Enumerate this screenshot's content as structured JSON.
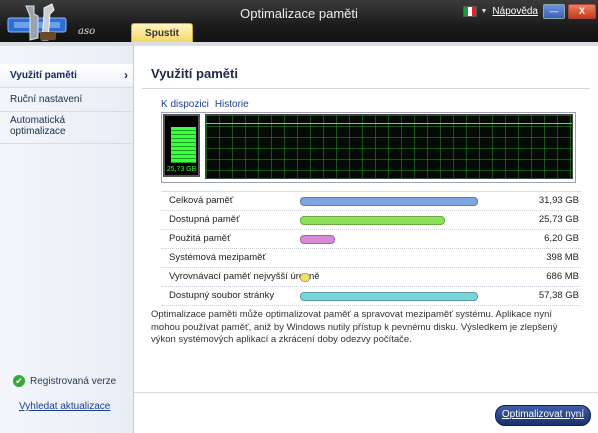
{
  "window": {
    "title": "Optimalizace paměti",
    "help_label": "Nápověda",
    "logo_text": "aso"
  },
  "tabs": {
    "run_label": "Spustit"
  },
  "sidebar": {
    "items": [
      {
        "label": "Využití paměti",
        "active": true
      },
      {
        "label": "Ruční nastavení",
        "active": false
      },
      {
        "label": "Automatická optimalizace",
        "active": false
      }
    ],
    "registered_label": "Registrovaná verze",
    "update_link": "Vyhledat aktualizace"
  },
  "main": {
    "title": "Využití paměti",
    "view_tabs": [
      "K dispozici",
      "Historie"
    ],
    "gauge_label": "25,73 GB",
    "gauge_fill": 0.81,
    "stats": [
      {
        "label": "Celková paměť",
        "value": "31,93 GB",
        "fill": 1.0,
        "color": "#7ea6e0"
      },
      {
        "label": "Dostupná paměť",
        "value": "25,73 GB",
        "fill": 0.81,
        "color": "#8ee05a"
      },
      {
        "label": "Použitá paměť",
        "value": "6,20 GB",
        "fill": 0.19,
        "color": "#d88ad6"
      },
      {
        "label": "Systémová mezipaměť",
        "value": "398 MB",
        "fill": 0,
        "color": "#cccccc"
      },
      {
        "label": "Vyrovnávací paměť nejvyšší úrovně",
        "value": "686 MB",
        "fill": 0.02,
        "color": "#f0e070"
      },
      {
        "label": "Dostupný soubor stránky",
        "value": "57,38 GB",
        "fill": 1.0,
        "color": "#7ad4d8"
      }
    ],
    "description": "Optimalizace paměti může optimalizovat paměť a spravovat mezipaměť systému. Aplikace nyní mohou používat paměť, aniž by Windows nutily přístup k pevnému disku. Výsledkem je zlepšený výkon systémových aplikací a zkrácení doby odezvy počítače.",
    "optimize_button": "Optimalizovat nyní"
  }
}
